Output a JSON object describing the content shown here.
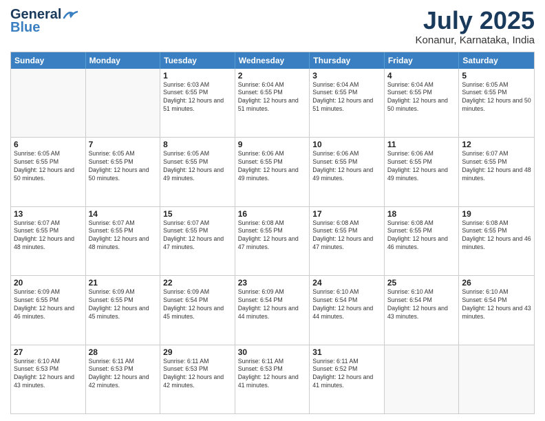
{
  "header": {
    "logo_line1": "General",
    "logo_line2": "Blue",
    "month_year": "July 2025",
    "location": "Konanur, Karnataka, India"
  },
  "days_of_week": [
    "Sunday",
    "Monday",
    "Tuesday",
    "Wednesday",
    "Thursday",
    "Friday",
    "Saturday"
  ],
  "weeks": [
    [
      {
        "day": "",
        "info": ""
      },
      {
        "day": "",
        "info": ""
      },
      {
        "day": "1",
        "info": "Sunrise: 6:03 AM\nSunset: 6:55 PM\nDaylight: 12 hours and 51 minutes."
      },
      {
        "day": "2",
        "info": "Sunrise: 6:04 AM\nSunset: 6:55 PM\nDaylight: 12 hours and 51 minutes."
      },
      {
        "day": "3",
        "info": "Sunrise: 6:04 AM\nSunset: 6:55 PM\nDaylight: 12 hours and 51 minutes."
      },
      {
        "day": "4",
        "info": "Sunrise: 6:04 AM\nSunset: 6:55 PM\nDaylight: 12 hours and 50 minutes."
      },
      {
        "day": "5",
        "info": "Sunrise: 6:05 AM\nSunset: 6:55 PM\nDaylight: 12 hours and 50 minutes."
      }
    ],
    [
      {
        "day": "6",
        "info": "Sunrise: 6:05 AM\nSunset: 6:55 PM\nDaylight: 12 hours and 50 minutes."
      },
      {
        "day": "7",
        "info": "Sunrise: 6:05 AM\nSunset: 6:55 PM\nDaylight: 12 hours and 50 minutes."
      },
      {
        "day": "8",
        "info": "Sunrise: 6:05 AM\nSunset: 6:55 PM\nDaylight: 12 hours and 49 minutes."
      },
      {
        "day": "9",
        "info": "Sunrise: 6:06 AM\nSunset: 6:55 PM\nDaylight: 12 hours and 49 minutes."
      },
      {
        "day": "10",
        "info": "Sunrise: 6:06 AM\nSunset: 6:55 PM\nDaylight: 12 hours and 49 minutes."
      },
      {
        "day": "11",
        "info": "Sunrise: 6:06 AM\nSunset: 6:55 PM\nDaylight: 12 hours and 49 minutes."
      },
      {
        "day": "12",
        "info": "Sunrise: 6:07 AM\nSunset: 6:55 PM\nDaylight: 12 hours and 48 minutes."
      }
    ],
    [
      {
        "day": "13",
        "info": "Sunrise: 6:07 AM\nSunset: 6:55 PM\nDaylight: 12 hours and 48 minutes."
      },
      {
        "day": "14",
        "info": "Sunrise: 6:07 AM\nSunset: 6:55 PM\nDaylight: 12 hours and 48 minutes."
      },
      {
        "day": "15",
        "info": "Sunrise: 6:07 AM\nSunset: 6:55 PM\nDaylight: 12 hours and 47 minutes."
      },
      {
        "day": "16",
        "info": "Sunrise: 6:08 AM\nSunset: 6:55 PM\nDaylight: 12 hours and 47 minutes."
      },
      {
        "day": "17",
        "info": "Sunrise: 6:08 AM\nSunset: 6:55 PM\nDaylight: 12 hours and 47 minutes."
      },
      {
        "day": "18",
        "info": "Sunrise: 6:08 AM\nSunset: 6:55 PM\nDaylight: 12 hours and 46 minutes."
      },
      {
        "day": "19",
        "info": "Sunrise: 6:08 AM\nSunset: 6:55 PM\nDaylight: 12 hours and 46 minutes."
      }
    ],
    [
      {
        "day": "20",
        "info": "Sunrise: 6:09 AM\nSunset: 6:55 PM\nDaylight: 12 hours and 46 minutes."
      },
      {
        "day": "21",
        "info": "Sunrise: 6:09 AM\nSunset: 6:55 PM\nDaylight: 12 hours and 45 minutes."
      },
      {
        "day": "22",
        "info": "Sunrise: 6:09 AM\nSunset: 6:54 PM\nDaylight: 12 hours and 45 minutes."
      },
      {
        "day": "23",
        "info": "Sunrise: 6:09 AM\nSunset: 6:54 PM\nDaylight: 12 hours and 44 minutes."
      },
      {
        "day": "24",
        "info": "Sunrise: 6:10 AM\nSunset: 6:54 PM\nDaylight: 12 hours and 44 minutes."
      },
      {
        "day": "25",
        "info": "Sunrise: 6:10 AM\nSunset: 6:54 PM\nDaylight: 12 hours and 43 minutes."
      },
      {
        "day": "26",
        "info": "Sunrise: 6:10 AM\nSunset: 6:54 PM\nDaylight: 12 hours and 43 minutes."
      }
    ],
    [
      {
        "day": "27",
        "info": "Sunrise: 6:10 AM\nSunset: 6:53 PM\nDaylight: 12 hours and 43 minutes."
      },
      {
        "day": "28",
        "info": "Sunrise: 6:11 AM\nSunset: 6:53 PM\nDaylight: 12 hours and 42 minutes."
      },
      {
        "day": "29",
        "info": "Sunrise: 6:11 AM\nSunset: 6:53 PM\nDaylight: 12 hours and 42 minutes."
      },
      {
        "day": "30",
        "info": "Sunrise: 6:11 AM\nSunset: 6:53 PM\nDaylight: 12 hours and 41 minutes."
      },
      {
        "day": "31",
        "info": "Sunrise: 6:11 AM\nSunset: 6:52 PM\nDaylight: 12 hours and 41 minutes."
      },
      {
        "day": "",
        "info": ""
      },
      {
        "day": "",
        "info": ""
      }
    ]
  ]
}
